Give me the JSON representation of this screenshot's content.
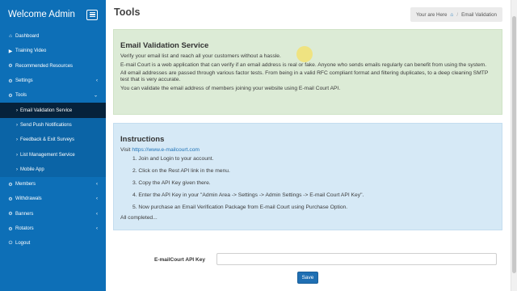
{
  "sidebar": {
    "title": "Welcome Admin",
    "items": [
      {
        "label": "Dashboard",
        "icon": "⌂"
      },
      {
        "label": "Training Video",
        "icon": "▶"
      },
      {
        "label": "Recommended Resources",
        "icon": "⚙"
      },
      {
        "label": "Settings",
        "icon": "⚙",
        "chevron": "‹"
      },
      {
        "label": "Tools",
        "icon": "⚙",
        "chevron": "⌄"
      },
      {
        "label": "Email Validation Service",
        "sub": true,
        "active": true
      },
      {
        "label": "Send Push Notifications",
        "sub": true
      },
      {
        "label": "Feedback & Exit Surveys",
        "sub": true
      },
      {
        "label": "List Management Service",
        "sub": true
      },
      {
        "label": "Mobile App",
        "sub": true
      },
      {
        "label": "Members",
        "icon": "⚙",
        "chevron": "‹"
      },
      {
        "label": "Withdrawals",
        "icon": "⚙",
        "chevron": "‹"
      },
      {
        "label": "Banners",
        "icon": "⚙",
        "chevron": "‹"
      },
      {
        "label": "Rotators",
        "icon": "⚙",
        "chevron": "‹"
      },
      {
        "label": "Logout",
        "icon": "⏻"
      }
    ]
  },
  "header": {
    "title": "Tools",
    "breadcrumb": {
      "prefix": "Your are Here",
      "current": "Email Validation"
    }
  },
  "intro": {
    "heading": "Email Validation Service",
    "paragraphs": [
      "Verify your email list and reach all your customers without a hassle.",
      "E-mail Court is a web application that can verify if an email address is real or fake. Anyone who sends emails regularly can benefit from using the system.",
      "All email addresses are passed through various factor tests. From being in a valid RFC compliant format and filtering duplicates, to a deep cleaning SMTP test that is very accurate.",
      "You can validate the email address of members joining your website using E-mail Court API."
    ]
  },
  "instructions": {
    "heading": "Instructions",
    "visit_prefix": "Visit",
    "visit_link": "https://www.e-mailcourt.com",
    "steps": [
      "1. Join and Login to your account.",
      "2. Click on the Rest API link in the menu.",
      "3. Copy the API Key given there.",
      "4. Enter the API Key in your \"Admin Area -> Settings -> Admin Settings -> E-mail Court API Key\".",
      "5. Now purchase an Email Verification Package from E-mail Court using Purchase Option."
    ],
    "footer": "All completed..."
  },
  "form": {
    "api_label": "E-mailCourt API Key",
    "api_value": "",
    "save_label": "Save"
  },
  "colors": {
    "sidebar": "#0d6fb7",
    "active_sub": "#06223b",
    "green_panel": "#dcebd6",
    "blue_panel": "#d6e9f6",
    "button": "#1f6fb3"
  }
}
